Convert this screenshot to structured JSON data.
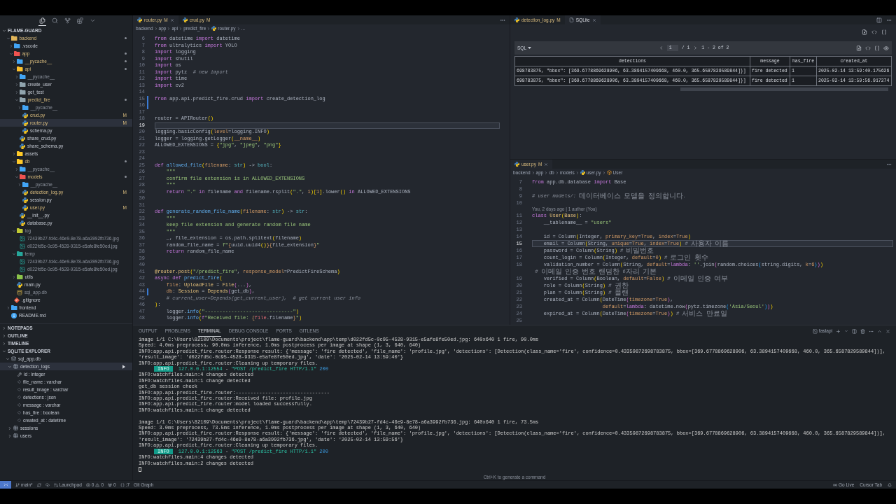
{
  "activity_bar": [
    {
      "selected": true
    },
    {
      "selected": false
    },
    {
      "selected": false
    },
    {
      "selected": false
    },
    {
      "selected": false
    }
  ],
  "explorer": {
    "title": "FLAME-GUARD",
    "expanded": true,
    "tree": [
      {
        "label": "backend",
        "kind": "folder",
        "color": "#e2b65a",
        "expanded": true,
        "modified": true,
        "ignored": false,
        "selected": false,
        "children": [
          {
            "label": ".vscode",
            "kind": "folder",
            "color": "#42a5f5",
            "expanded": false,
            "modified": false,
            "ignored": false,
            "selected": false
          },
          {
            "label": "app",
            "kind": "folder",
            "color": "#ef5350",
            "expanded": true,
            "modified": true,
            "ignored": false,
            "selected": false,
            "children": [
              {
                "label": "__pycache__",
                "kind": "folder",
                "color": "#42a5f5",
                "expanded": false,
                "modified": true,
                "ignored": false,
                "selected": false
              },
              {
                "label": "api",
                "kind": "folder",
                "color": "#fbc02d",
                "expanded": true,
                "modified": true,
                "ignored": false,
                "selected": false,
                "children": [
                  {
                    "label": "__pycache__",
                    "kind": "folder",
                    "color": "#42a5f5",
                    "expanded": false,
                    "modified": false,
                    "ignored": true,
                    "selected": false
                  },
                  {
                    "label": "create_user",
                    "kind": "folder",
                    "color": "#90a4ae",
                    "expanded": false,
                    "modified": false,
                    "ignored": false,
                    "selected": false
                  },
                  {
                    "label": "get_test",
                    "kind": "folder",
                    "color": "#90a4ae",
                    "expanded": false,
                    "modified": false,
                    "ignored": false,
                    "selected": false
                  },
                  {
                    "label": "predict_fire",
                    "kind": "folder",
                    "color": "#90a4ae",
                    "expanded": true,
                    "modified": true,
                    "ignored": false,
                    "selected": false,
                    "children": [
                      {
                        "label": "__pycache__",
                        "kind": "folder",
                        "color": "#42a5f5",
                        "expanded": false,
                        "modified": false,
                        "ignored": true,
                        "selected": false
                      },
                      {
                        "label": "crud.py",
                        "kind": "python",
                        "modified": true,
                        "ignored": false,
                        "badge": "M",
                        "selected": false
                      },
                      {
                        "label": "router.py",
                        "kind": "python",
                        "modified": true,
                        "ignored": false,
                        "badge": "M",
                        "selected": true
                      },
                      {
                        "label": "schema.py",
                        "kind": "python",
                        "modified": false,
                        "ignored": false,
                        "selected": false
                      }
                    ]
                  },
                  {
                    "label": "share_crud.py",
                    "kind": "python",
                    "modified": false,
                    "ignored": false,
                    "selected": false
                  },
                  {
                    "label": "share_schema.py",
                    "kind": "python",
                    "modified": false,
                    "ignored": false,
                    "selected": false
                  }
                ]
              },
              {
                "label": "assets",
                "kind": "folder",
                "color": "#ffca28",
                "expanded": false,
                "modified": false,
                "ignored": false,
                "selected": false
              },
              {
                "label": "db",
                "kind": "folder",
                "color": "#ffca28",
                "expanded": true,
                "modified": true,
                "ignored": false,
                "selected": false,
                "children": [
                  {
                    "label": "__pycache__",
                    "kind": "folder",
                    "color": "#42a5f5",
                    "expanded": false,
                    "modified": false,
                    "ignored": true,
                    "selected": false
                  },
                  {
                    "label": "models",
                    "kind": "folder",
                    "color": "#ef5350",
                    "expanded": true,
                    "modified": true,
                    "ignored": false,
                    "selected": false,
                    "children": [
                      {
                        "label": "__pycache__",
                        "kind": "folder",
                        "color": "#42a5f5",
                        "expanded": false,
                        "modified": false,
                        "ignored": true,
                        "selected": false
                      },
                      {
                        "label": "detection_log.py",
                        "kind": "python",
                        "modified": true,
                        "ignored": false,
                        "badge": "M",
                        "selected": false
                      },
                      {
                        "label": "session.py",
                        "kind": "python",
                        "modified": false,
                        "ignored": false,
                        "selected": false
                      },
                      {
                        "label": "user.py",
                        "kind": "python",
                        "modified": true,
                        "ignored": false,
                        "badge": "M",
                        "selected": false
                      }
                    ]
                  },
                  {
                    "label": "__init__.py",
                    "kind": "python",
                    "modified": false,
                    "ignored": false,
                    "selected": false
                  },
                  {
                    "label": "database.py",
                    "kind": "python",
                    "modified": false,
                    "ignored": false,
                    "selected": false
                  }
                ]
              },
              {
                "label": "log",
                "kind": "folder",
                "color": "#c0ca33",
                "expanded": true,
                "modified": false,
                "ignored": true,
                "selected": false,
                "children": [
                  {
                    "label": "72439b27-fd4c-46e9-8e78-a6a3992fb736.jpg",
                    "kind": "image",
                    "modified": false,
                    "ignored": true,
                    "selected": false
                  },
                  {
                    "label": "d022fd5c-0c95-4528-9315-e5afe8fe50ed.jpg",
                    "kind": "image",
                    "modified": false,
                    "ignored": true,
                    "selected": false
                  }
                ]
              },
              {
                "label": "temp",
                "kind": "folder",
                "color": "#26a69a",
                "expanded": true,
                "modified": false,
                "ignored": true,
                "selected": false,
                "children": [
                  {
                    "label": "72439b27-fd4c-46e9-8e78-a6a3992fb736.jpg",
                    "kind": "image",
                    "modified": false,
                    "ignored": true,
                    "selected": false
                  },
                  {
                    "label": "d022fd5c-0c95-4528-9315-e5afe8fe50ed.jpg",
                    "kind": "image",
                    "modified": false,
                    "ignored": true,
                    "selected": false
                  }
                ]
              },
              {
                "label": "utils",
                "kind": "folder",
                "color": "#8bc34a",
                "expanded": false,
                "modified": false,
                "ignored": false,
                "selected": false
              },
              {
                "label": "main.py",
                "kind": "python",
                "modified": false,
                "ignored": false,
                "selected": false
              },
              {
                "label": "sql_app.db",
                "kind": "database",
                "modified": false,
                "ignored": true,
                "selected": false
              }
            ]
          },
          {
            "label": ".gitignore",
            "kind": "git",
            "modified": false,
            "ignored": false,
            "selected": false
          }
        ]
      },
      {
        "label": "frontend",
        "kind": "folder",
        "color": "#42a5f5",
        "expanded": false,
        "modified": false,
        "ignored": false,
        "selected": false
      },
      {
        "label": "README.md",
        "kind": "info",
        "modified": false,
        "ignored": false,
        "selected": false
      }
    ]
  },
  "side_sections": [
    {
      "title": "NOTEPADS",
      "expanded": false
    },
    {
      "title": "OUTLINE",
      "expanded": false
    },
    {
      "title": "TIMELINE",
      "expanded": false
    }
  ],
  "sqlite_explorer": {
    "title": "SQLITE EXPLORER",
    "expanded": true,
    "databases": [
      {
        "label": "sql_app.db",
        "expanded": true,
        "tables": [
          {
            "label": "detection_logs",
            "expanded": true,
            "selected": true,
            "columns": [
              {
                "label": "id : integer",
                "primary_key": true
              },
              {
                "label": "file_name : varchar",
                "primary_key": false
              },
              {
                "label": "result_image : varchar",
                "primary_key": false
              },
              {
                "label": "detections : json",
                "primary_key": false
              },
              {
                "label": "message : varchar",
                "primary_key": false
              },
              {
                "label": "has_fire : boolean",
                "primary_key": false
              },
              {
                "label": "created_at : datetime",
                "primary_key": false
              }
            ]
          },
          {
            "label": "sessions",
            "expanded": false,
            "selected": false
          },
          {
            "label": "users",
            "expanded": false,
            "selected": false
          }
        ]
      }
    ]
  },
  "left_editor": {
    "tabs": [
      {
        "label": "router.py",
        "kind": "python",
        "modified": true,
        "badge": "M",
        "selected": true
      },
      {
        "label": "crud.py",
        "kind": "python",
        "modified": true,
        "badge": "M",
        "selected": false
      }
    ],
    "breadcrumb": [
      {
        "kind": "path",
        "label": "backend"
      },
      {
        "kind": "path",
        "label": "app"
      },
      {
        "kind": "path",
        "label": "api"
      },
      {
        "kind": "path",
        "label": "predict_fire"
      },
      {
        "kind": "python",
        "label": "router.py"
      },
      {
        "kind": "path",
        "label": "..."
      }
    ],
    "lines": [
      {
        "no": "6",
        "current": false,
        "changed": false,
        "code": [
          {
            "keyword": "from"
          },
          " datetime ",
          {
            "keyword": "import"
          },
          " datetime"
        ]
      },
      {
        "no": "7",
        "current": false,
        "changed": false,
        "code": [
          {
            "keyword": "from"
          },
          " ultralytics ",
          {
            "keyword": "import"
          },
          " YOLO"
        ]
      },
      {
        "no": "8",
        "current": false,
        "changed": false,
        "code": [
          {
            "keyword": "import"
          },
          " logging"
        ]
      },
      {
        "no": "9",
        "current": false,
        "changed": false,
        "code": [
          {
            "keyword": "import"
          },
          " shutil"
        ]
      },
      {
        "no": "10",
        "current": false,
        "changed": false,
        "code": [
          {
            "keyword": "import"
          },
          " os"
        ]
      },
      {
        "no": "11",
        "current": false,
        "changed": false,
        "code": [
          {
            "keyword": "import"
          },
          " pytz  ",
          {
            "comment": "# new import"
          }
        ]
      },
      {
        "no": "12",
        "current": false,
        "changed": false,
        "code": [
          {
            "keyword": "import"
          },
          " time"
        ]
      },
      {
        "no": "13",
        "current": false,
        "changed": false,
        "code": [
          {
            "keyword": "import"
          },
          " cv2"
        ]
      },
      {
        "no": "14",
        "current": false,
        "changed": false
      },
      {
        "no": "15",
        "current": false,
        "changed": true,
        "code": [
          {
            "keyword": "from"
          },
          " app.api.predict_fire.crud ",
          {
            "keyword": "import"
          },
          " create_detection_log"
        ]
      },
      {
        "no": "16",
        "current": false,
        "changed": true
      },
      {
        "no": "17",
        "current": false,
        "changed": false
      },
      {
        "no": "18",
        "current": false,
        "changed": false,
        "code": [
          "router = APIRouter",
          {
            "br1": "()"
          }
        ]
      },
      {
        "no": "19",
        "current": true,
        "changed": false
      },
      {
        "no": "20",
        "current": false,
        "changed": false,
        "code": [
          "logging.basicConfig",
          {
            "br1": "("
          },
          {
            "param": "level"
          },
          "=logging.INFO",
          {
            "br1": ")"
          }
        ]
      },
      {
        "no": "21",
        "current": false,
        "changed": false,
        "code": [
          "logger = logging.getLogger",
          {
            "br1": "("
          },
          {
            "param": "__name__"
          },
          {
            "br1": ")"
          }
        ]
      },
      {
        "no": "22",
        "current": false,
        "changed": false,
        "code": [
          "ALLOWED_EXTENSIONS = ",
          {
            "br1": "{"
          },
          {
            "string": "\"jpg\""
          },
          ", ",
          {
            "string": "\"jpeg\""
          },
          ", ",
          {
            "string": "\"png\""
          },
          {
            "br1": "}"
          }
        ]
      },
      {
        "no": "23",
        "current": false,
        "changed": false
      },
      {
        "no": "24",
        "current": false,
        "changed": false
      },
      {
        "no": "25",
        "current": false,
        "changed": false,
        "code": [
          {
            "keyword": "def "
          },
          {
            "func": "allowed_file"
          },
          {
            "br1": "("
          },
          {
            "param": "filename"
          },
          ": ",
          {
            "builtin": "str"
          },
          {
            "br1": ")"
          },
          " -> ",
          {
            "builtin": "bool"
          },
          ":"
        ]
      },
      {
        "no": "26",
        "current": false,
        "changed": false,
        "code": [
          {
            "string": "    \"\"\""
          }
        ]
      },
      {
        "no": "27",
        "current": false,
        "changed": false,
        "code": [
          {
            "string": "    confirm file extension is in ALLOWED_EXTENSIONS"
          }
        ]
      },
      {
        "no": "28",
        "current": false,
        "changed": false,
        "code": [
          {
            "string": "    \"\"\""
          }
        ]
      },
      {
        "no": "29",
        "current": false,
        "changed": false,
        "code": [
          {
            "keyword": "    return "
          },
          {
            "string": "\".\""
          },
          {
            "keyword": " in"
          },
          " filename ",
          {
            "keyword": "and"
          },
          " filename.rsplit",
          {
            "br1": "("
          },
          {
            "string": "\".\""
          },
          ", ",
          {
            "number": "1"
          },
          {
            "br1": ")["
          },
          {
            "number": "1"
          },
          {
            "br1": "]"
          },
          ".lower",
          {
            "br1": "()"
          },
          {
            "keyword": " in"
          },
          " ALLOWED_EXTENSIONS"
        ]
      },
      {
        "no": "30",
        "current": false,
        "changed": false
      },
      {
        "no": "31",
        "current": false,
        "changed": false
      },
      {
        "no": "32",
        "current": false,
        "changed": false,
        "code": [
          {
            "keyword": "def "
          },
          {
            "func": "generate_random_file_name"
          },
          {
            "br1": "("
          },
          {
            "param": "filename"
          },
          ": ",
          {
            "builtin": "str"
          },
          {
            "br1": ")"
          },
          " -> ",
          {
            "builtin": "str"
          },
          ":"
        ]
      },
      {
        "no": "33",
        "current": false,
        "changed": false,
        "code": [
          {
            "string": "    \"\"\""
          }
        ]
      },
      {
        "no": "34",
        "current": false,
        "changed": false,
        "code": [
          {
            "string": "    keep file extension and generate random file name"
          }
        ]
      },
      {
        "no": "35",
        "current": false,
        "changed": false,
        "code": [
          {
            "string": "    \"\"\""
          }
        ]
      },
      {
        "no": "36",
        "current": false,
        "changed": false,
        "code": [
          "    _, file_extension = os.path.splitext",
          {
            "br1": "("
          },
          "filename",
          {
            "br1": ")"
          }
        ]
      },
      {
        "no": "37",
        "current": false,
        "changed": false,
        "code": [
          "    random_file_name = ",
          {
            "string": "f\""
          },
          {
            "number": "{"
          },
          "uuid.uuid4",
          {
            "br1": "()"
          },
          {
            "number": "}{"
          },
          "file_extension",
          {
            "number": "}"
          },
          {
            "string": "\""
          }
        ]
      },
      {
        "no": "38",
        "current": false,
        "changed": false,
        "code": [
          {
            "keyword": "    return"
          },
          " random_file_name"
        ]
      },
      {
        "no": "39",
        "current": false,
        "changed": false
      },
      {
        "no": "40",
        "current": false,
        "changed": false
      },
      {
        "no": "41",
        "current": false,
        "changed": false,
        "code": [
          {
            "decorator": "@router.post"
          },
          {
            "br1": "("
          },
          {
            "string": "\"/predict_fire\""
          },
          ", ",
          {
            "param": "response_model"
          },
          "=PredictFireSchema",
          {
            "br1": ")"
          }
        ]
      },
      {
        "no": "42",
        "current": false,
        "changed": false,
        "code": [
          {
            "keyword": "async def "
          },
          {
            "func": "predict_fire"
          },
          {
            "br1": "("
          }
        ]
      },
      {
        "no": "43",
        "current": false,
        "changed": false,
        "code": [
          {
            "param": "    file"
          },
          ": ",
          {
            "type": "UploadFile"
          },
          " = ",
          {
            "type": "File"
          },
          {
            "br2": "("
          },
          "...",
          {
            "br2": ")"
          },
          ","
        ]
      },
      {
        "no": "44",
        "current": false,
        "changed": true,
        "code": [
          {
            "param": "    db"
          },
          ": ",
          {
            "type": "Session"
          },
          " = ",
          {
            "type": "Depends"
          },
          {
            "br2": "("
          },
          "get_db",
          {
            "br2": ")"
          },
          ","
        ]
      },
      {
        "no": "45",
        "current": false,
        "changed": false,
        "code": [
          {
            "comment": "    # current_user=Depends(get_current_user),  # get current user info"
          }
        ]
      },
      {
        "no": "46",
        "current": false,
        "changed": false,
        "code": [
          {
            "br1": ")"
          },
          ":"
        ]
      },
      {
        "no": "47",
        "current": false,
        "changed": false,
        "code": [
          "    logger.",
          {
            "func": "info"
          },
          {
            "br1": "("
          },
          {
            "string": "\"------------------------------\""
          },
          {
            "br1": ")"
          }
        ]
      },
      {
        "no": "48",
        "current": false,
        "changed": false,
        "code": [
          "    logger.",
          {
            "func": "info"
          },
          {
            "br1": "("
          },
          {
            "keyword": "f"
          },
          {
            "string": "\"Received file: "
          },
          {
            "number": "{"
          },
          {
            "var": "file"
          },
          ".filename",
          {
            "number": "}"
          },
          {
            "string": "\""
          },
          {
            "br1": ")"
          }
        ]
      }
    ]
  },
  "sqlite_group": {
    "tabs": [
      {
        "label": "detection_log.py",
        "kind": "python",
        "modified": true,
        "badge": "M",
        "selected": false
      },
      {
        "label": "SQLite",
        "kind": "webview",
        "modified": false,
        "selected": true
      }
    ]
  },
  "sqlite_view": {
    "query_mode": "SQL",
    "page": "1",
    "page_total": "/ 1",
    "range": "1 - 2 of 2",
    "columns": [
      "detections",
      "message",
      "has_fire",
      "created_at"
    ],
    "rows": [
      [
        "698783875, \"bbox\": [369.6778869628906, 63.3894157409668, 460.0, 365.6587829589844]}]",
        "fire detected",
        "1",
        "2025-02-14 13:59:40.175626"
      ],
      [
        "698783875, \"bbox\": [369.6778869628906, 63.3894157409668, 460.0, 365.6587829589844]}]",
        "fire detected",
        "1",
        "2025-02-14 13:59:56.917274"
      ]
    ]
  },
  "right_editor": {
    "tabs": [
      {
        "label": "user.py",
        "kind": "python",
        "modified": true,
        "badge": "M",
        "selected": true
      }
    ],
    "breadcrumb": [
      {
        "kind": "path",
        "label": "backend"
      },
      {
        "kind": "path",
        "label": "app"
      },
      {
        "kind": "path",
        "label": "db"
      },
      {
        "kind": "path",
        "label": "models"
      },
      {
        "kind": "python",
        "label": "user.py"
      },
      {
        "kind": "class",
        "label": "User"
      }
    ],
    "lines": [
      {
        "no": "7",
        "current": false,
        "code": [
          {
            "keyword": "from"
          },
          " app.db.database ",
          {
            "keyword": "import"
          },
          " Base"
        ]
      },
      {
        "no": "8",
        "current": false
      },
      {
        "no": "9",
        "current": false,
        "code": [
          {
            "comment": "# user models/: 데이터베이스 모델을 정의합니다."
          }
        ]
      },
      {
        "no": "10",
        "current": false
      },
      {
        "no": "11",
        "current": false,
        "codelens": "You, 2 days ago | 1 author (You)",
        "code": [
          {
            "keyword": "class "
          },
          {
            "type": "User"
          },
          {
            "br1": "("
          },
          {
            "type": "Base"
          },
          {
            "br1": ")"
          },
          ":"
        ]
      },
      {
        "no": "12",
        "current": false,
        "code": [
          "    __tablename__ = ",
          {
            "string": "\"users\""
          }
        ]
      },
      {
        "no": "13",
        "current": false
      },
      {
        "no": "14",
        "current": false,
        "code": [
          "    id = Column",
          {
            "br1": "("
          },
          "Integer, ",
          {
            "param": "primary_key"
          },
          "=",
          {
            "number": "True"
          },
          ", ",
          {
            "param": "index"
          },
          "=",
          {
            "number": "True"
          },
          {
            "br1": ")"
          }
        ]
      },
      {
        "no": "15",
        "current": true,
        "code": [
          "    email = Column",
          {
            "br1": "("
          },
          "String, ",
          {
            "param": "unique"
          },
          "=",
          {
            "number": "True"
          },
          ", ",
          {
            "param": "index"
          },
          "=",
          {
            "number": "True"
          },
          {
            "br1": ")"
          },
          {
            "comment": " # 사용자 이름"
          }
        ]
      },
      {
        "no": "16",
        "current": false,
        "code": [
          "    password = Column",
          {
            "br1": "("
          },
          "String",
          {
            "br1": ")"
          },
          {
            "comment": " # 비밀번호"
          }
        ]
      },
      {
        "no": "17",
        "current": false,
        "code": [
          "    count_login = Column",
          {
            "br1": "("
          },
          "Integer, ",
          {
            "param": "default"
          },
          "=",
          {
            "number": "0"
          },
          {
            "br1": ")"
          },
          {
            "comment": " # 로그인 횟수"
          }
        ]
      },
      {
        "no": "18",
        "current": false,
        "code": [
          "    validation_number = Column",
          {
            "br1": "("
          },
          "String, ",
          {
            "param": "default"
          },
          "=",
          {
            "keyword": "lambda"
          },
          ": ",
          {
            "string": "''"
          },
          ".join",
          {
            "br2": "("
          },
          "random.choices",
          {
            "br3": "("
          },
          "string.digits, ",
          {
            "param": "k"
          },
          "=",
          {
            "number": "6"
          },
          {
            "br3": ")"
          },
          {
            "br2": ")"
          },
          {
            "br1": ")"
          },
          {
            "comment": " # 이메일 인증 번호 랜덤한 6자리 기본"
          }
        ]
      },
      {
        "no": "19",
        "current": false,
        "code": [
          "    verified = Column",
          {
            "br1": "("
          },
          "Boolean, ",
          {
            "param": "default"
          },
          "=",
          {
            "number": "False"
          },
          {
            "br1": ")"
          },
          {
            "comment": " # 이메일 인증 여부"
          }
        ]
      },
      {
        "no": "20",
        "current": false,
        "code": [
          "    role = Column",
          {
            "br1": "("
          },
          "String",
          {
            "br1": ")"
          },
          {
            "comment": " # 권한"
          }
        ]
      },
      {
        "no": "21",
        "current": false,
        "code": [
          "    plan = Column",
          {
            "br1": "("
          },
          "String",
          {
            "br1": ")"
          },
          {
            "comment": " # 플랜"
          }
        ]
      },
      {
        "no": "22",
        "current": false,
        "code": [
          "    created_at = Column",
          {
            "br1": "("
          },
          "DateTime",
          {
            "br2": "("
          },
          {
            "param": "timezone"
          },
          "=",
          {
            "number": "True"
          },
          {
            "br2": ")"
          },
          ","
        ]
      },
      {
        "no": "23",
        "current": false,
        "code": [
          {
            "param": "                        default"
          },
          "=",
          {
            "keyword": "lambda"
          },
          ": datetime.now",
          {
            "br2": "("
          },
          "pytz.timezone",
          {
            "br3": "("
          },
          {
            "string": "'Asia/Seoul'"
          },
          {
            "br3": ")"
          },
          {
            "br2": ")"
          },
          {
            "br1": ")"
          }
        ]
      },
      {
        "no": "24",
        "current": false,
        "code": [
          "    expired_at = Column",
          {
            "br1": "("
          },
          "DateTime",
          {
            "br2": "("
          },
          {
            "param": "timezone"
          },
          "=",
          {
            "number": "True"
          },
          {
            "br2": ")"
          },
          {
            "br1": ")"
          },
          {
            "comment": " # 서비스 만료일"
          }
        ]
      },
      {
        "no": "25",
        "current": false
      }
    ]
  },
  "panel": {
    "tabs": [
      {
        "label": "OUTPUT",
        "selected": false
      },
      {
        "label": "PROBLEMS",
        "selected": false
      },
      {
        "label": "TERMINAL",
        "selected": true
      },
      {
        "label": "DEBUG CONSOLE",
        "selected": false
      },
      {
        "label": "PORTS",
        "selected": false
      },
      {
        "label": "GITLENS",
        "selected": false
      }
    ],
    "terminal_name": "fastapi",
    "blocks": [
      [
        [
          "image 1/1 C:\\Users\\82109\\Documents\\project\\flame-guard\\backend\\app\\temp\\d022fd5c-0c95-4528-9315-e5afe8fe50ed.jpg: 640x640 1 fire, 90.0ms"
        ],
        [
          "Speed: 4.0ms preprocess, 90.0ms inference, 1.0ms postprocess per image at shape (1, 3, 640, 640)"
        ],
        [
          "INFO:app.api.predict_fire.router:Response result: {'message': 'fire detected', 'file_name': 'profile.jpg', 'detections': [Detection(class_name='fire', confidence=0.43359872698783875, bbox=[369.6778869628906, 63.3894157409668, 460.0, 365.6587829589844])], 'result_image': 'd022fd5c-0c95-4528-9315-e5afe8fe50ed.jpg', 'date': '2025-02-14 13:59:40'}"
        ],
        [
          "INFO:app.api.predict_fire.router:Cleaning up temporary files."
        ],
        [
          {
            "badge": "INFO"
          },
          {
            "address": "127.0.0.1:12554"
          },
          " - ",
          {
            "request": "\"POST /predict_fire HTTP/1.1\""
          },
          {
            "status_code": "200"
          }
        ],
        [
          "INFO:watchfiles.main:4 changes detected"
        ],
        [
          "INFO:watchfiles.main:1 change detected"
        ],
        [
          "get_db session check"
        ],
        [
          "INFO:app.api.predict_fire.router:--------------------------------"
        ],
        [
          "INFO:app.api.predict_fire.router:Received file: profile.jpg"
        ],
        [
          "INFO:app.api.predict_fire.router:model loaded successfully."
        ],
        [
          "INFO:watchfiles.main:1 change detected"
        ]
      ],
      [
        [
          "image 1/1 C:\\Users\\82109\\Documents\\project\\flame-guard\\backend\\app\\temp\\72439b27-fd4c-46e9-8e78-a6a3992fb736.jpg: 640x640 1 fire, 73.5ms"
        ],
        [
          "Speed: 3.0ms preprocess, 73.5ms inference, 1.0ms postprocess per image at shape (1, 3, 640, 640)"
        ],
        [
          "INFO:app.api.predict_fire.router:Response result: {'message': 'fire detected', 'file_name': 'profile.jpg', 'detections': [Detection(class_name='fire', confidence=0.43359872698783875, bbox=[369.6778869628906, 63.3894157409668, 460.0, 365.6587829589844])], 'result_image': '72439b27-fd4c-46e9-8e78-a6a3992fb736.jpg', 'date': '2025-02-14 13:59:56'}"
        ],
        [
          "INFO:app.api.predict_fire.router:Cleaning up temporary files."
        ],
        [
          {
            "badge": "INFO"
          },
          {
            "address": "127.0.0.1:12563"
          },
          " - ",
          {
            "request": "\"POST /predict_fire HTTP/1.1\""
          },
          {
            "status_code": "200"
          }
        ],
        [
          "INFO:watchfiles.main:4 changes detected"
        ],
        [
          "INFO:watchfiles.main:2 changes detected"
        ]
      ]
    ],
    "hint": "Ctrl+K to generate a command"
  },
  "status_bar": {
    "branch": "main*",
    "launchpad": "Launchpad",
    "errors": "0",
    "warnings": "0",
    "counter": "0",
    "line": ":7",
    "git_graph": "Git Graph",
    "go_live": "Go Live",
    "cursor_tab": "Cursor Tab"
  }
}
